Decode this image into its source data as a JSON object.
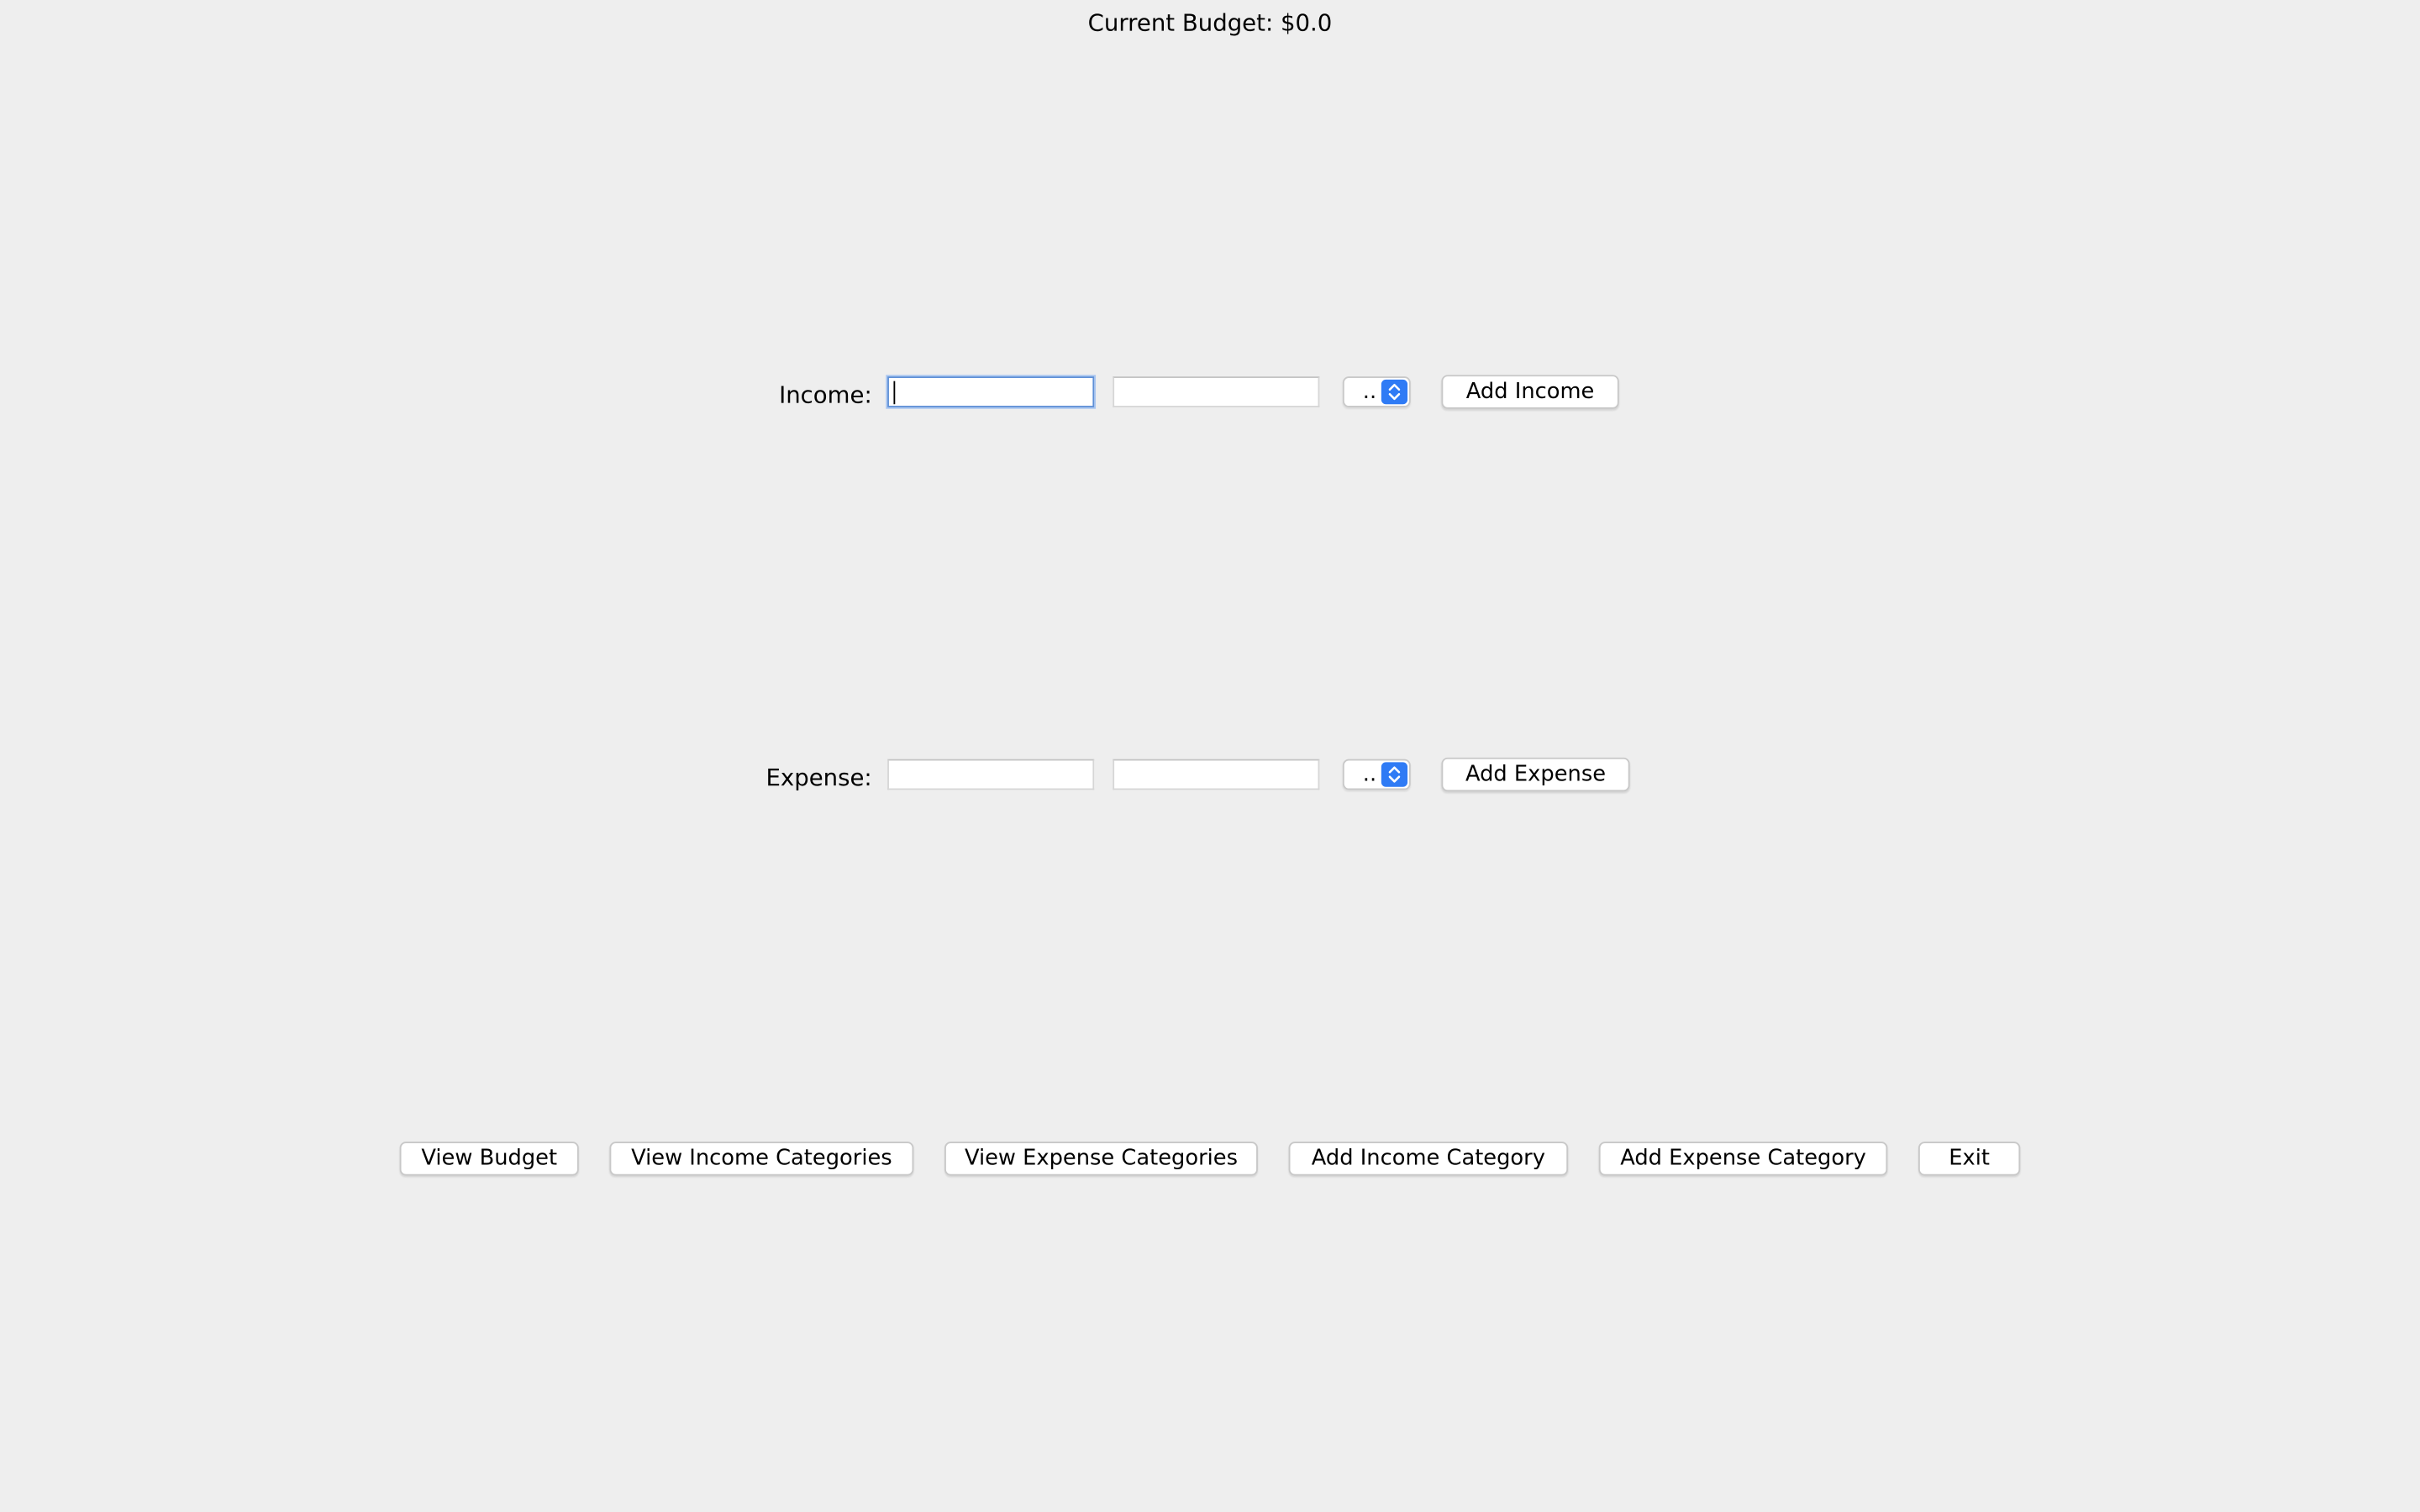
{
  "header": {
    "budget_label": "Current Budget: $0.0"
  },
  "income": {
    "label": "Income:",
    "amount_value": "",
    "description_value": "",
    "category_selected": "..",
    "add_button": "Add Income"
  },
  "expense": {
    "label": "Expense:",
    "amount_value": "",
    "description_value": "",
    "category_selected": "..",
    "add_button": "Add Expense"
  },
  "actions": {
    "view_budget": "View Budget",
    "view_income_categories": "View Income Categories",
    "view_expense_categories": "View Expense Categories",
    "add_income_category": "Add Income Category",
    "add_expense_category": "Add Expense Category",
    "exit": "Exit"
  },
  "colors": {
    "background": "#eeeeee",
    "accent": "#2f7bf5",
    "focus_ring": "#5e8fd6"
  },
  "icons": {
    "combo_arrow": "up-down-chevron-icon"
  }
}
